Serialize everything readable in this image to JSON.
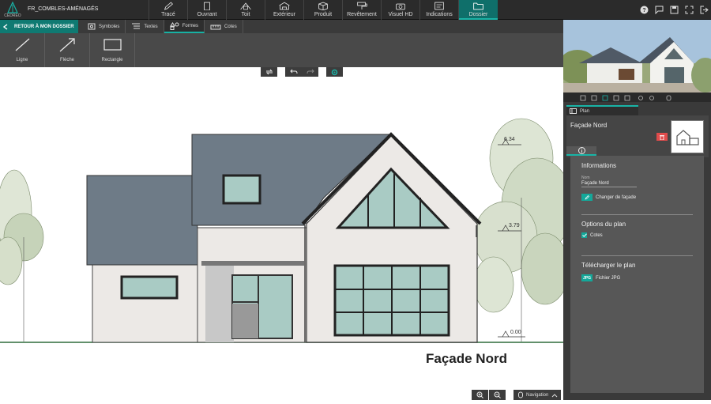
{
  "app": {
    "logo_text": "CEDREO",
    "project_name": "FR_COMBLES-AMÉNAGÉS"
  },
  "menu": [
    {
      "label": "Tracé",
      "icon": "pencil-icon"
    },
    {
      "label": "Ouvrant",
      "icon": "door-icon"
    },
    {
      "label": "Toit",
      "icon": "roof-icon"
    },
    {
      "label": "Extérieur",
      "icon": "fence-icon"
    },
    {
      "label": "Produit",
      "icon": "box-icon"
    },
    {
      "label": "Revêtement",
      "icon": "paint-roller-icon"
    },
    {
      "label": "Visuel HD",
      "icon": "camera-icon"
    },
    {
      "label": "Indications",
      "icon": "indications-icon"
    },
    {
      "label": "Dossier",
      "icon": "folder-icon",
      "active": true
    }
  ],
  "top_right_icons": [
    "help-icon",
    "chat-icon",
    "save-icon",
    "fullscreen-icon",
    "logout-icon"
  ],
  "subbar": {
    "back_label": "RETOUR À MON DOSSIER",
    "tabs": [
      {
        "label": "Symboles",
        "icon": "symbols-icon"
      },
      {
        "label": "Textes",
        "icon": "text-icon"
      },
      {
        "label": "Formes",
        "icon": "shapes-icon",
        "active": true
      },
      {
        "label": "Cotes",
        "icon": "ruler-icon"
      }
    ]
  },
  "tools": [
    {
      "label": "Ligne",
      "icon": "line-icon"
    },
    {
      "label": "Flèche",
      "icon": "arrow-icon"
    },
    {
      "label": "Rectangle",
      "icon": "rectangle-icon"
    }
  ],
  "canvas": {
    "title": "Façade Nord",
    "level_labels": [
      "6.34",
      "3.79",
      "0.00"
    ],
    "navigation_label": "Navigation"
  },
  "right_panel": {
    "plan_tab": "Plan",
    "plan_name": "Façade Nord",
    "informations_title": "Informations",
    "name_label": "Nom",
    "name_value": "Façade Nord",
    "change_label": "Changer de façade",
    "options_title": "Options du plan",
    "cotes_label": "Cotes",
    "cotes_checked": true,
    "download_title": "Télécharger le plan",
    "jpg_badge": "JPG",
    "jpg_label": "Fichier JPG"
  },
  "colors": {
    "accent": "#14a89a",
    "active_menu": "#0f6f6a",
    "delete": "#e04b4b",
    "roof": "#6e7b87",
    "glass": "#a9cbc4"
  }
}
